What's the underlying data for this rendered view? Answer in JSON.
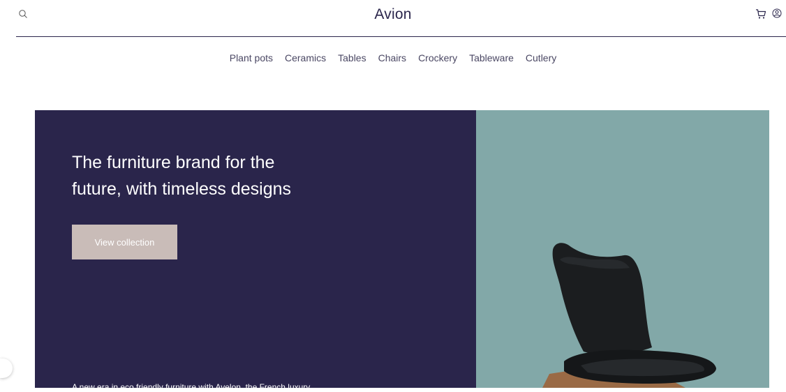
{
  "header": {
    "brand": "Avion",
    "icons": {
      "search": "search-icon",
      "cart": "cart-icon",
      "user": "user-icon"
    }
  },
  "nav": {
    "items": [
      "Plant pots",
      "Ceramics",
      "Tables",
      "Chairs",
      "Crockery",
      "Tableware",
      "Cutlery"
    ]
  },
  "hero": {
    "title": "The furniture brand for the future, with timeless designs",
    "cta_label": "View collection",
    "description": "A new era in eco friendly furniture with Avelon, the French luxury",
    "image": "black-chair-image"
  },
  "colors": {
    "dark": "#2a254b",
    "teal": "#82a8a8",
    "button": "#c9bcb8",
    "white": "#ffffff"
  }
}
